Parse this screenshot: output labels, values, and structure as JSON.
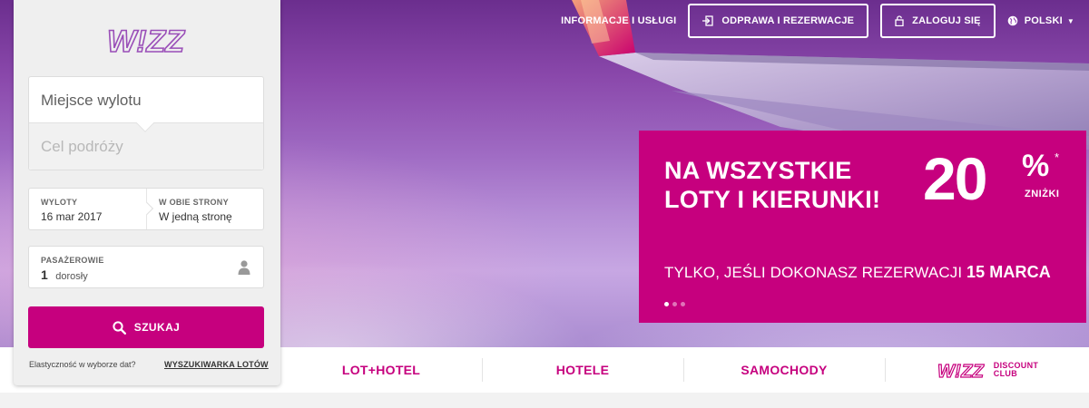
{
  "header": {
    "info_link": "INFORMACJE I USŁUGI",
    "checkin_button": "ODPRAWA I REZERWACJE",
    "login_button": "ZALOGUJ SIĘ",
    "language": "POLSKI"
  },
  "search": {
    "logo_text": "W!ZZ",
    "origin_placeholder": "Miejsce wylotu",
    "destination_placeholder": "Cel podróży",
    "departure_label": "WYLOTY",
    "departure_value": "16 mar 2017",
    "return_label": "W OBIE STRONY",
    "return_value": "W jedną stronę",
    "passengers_label": "PASAŻEROWIE",
    "passengers_count": "1",
    "passengers_unit": "dorosły",
    "search_button": "SZUKAJ",
    "flexibility_text": "Elastyczność w wyborze dat?",
    "flight_finder_link": "WYSZUKIWARKA LOTÓW"
  },
  "promo": {
    "line1": "NA WSZYSTKIE",
    "line2": "LOTY I KIERUNKI!",
    "discount_number": "20",
    "discount_symbol": "%",
    "asterisk": "*",
    "discount_word": "ZNIŻKI",
    "subtitle": "TYLKO, JEŚLI DOKONASZ REZERWACJI",
    "subtitle_date": "15 MARCA",
    "slides_total": 3,
    "active_slide": 1
  },
  "bottom_nav": {
    "items": [
      "LOT+HOTEL",
      "HOTELE",
      "SAMOCHODY"
    ],
    "club_logo": "W!ZZ",
    "club_line1": "DISCOUNT",
    "club_line2": "CLUB"
  },
  "colors": {
    "brand_magenta": "#c6007e",
    "brand_purple": "#9a4fb8"
  }
}
